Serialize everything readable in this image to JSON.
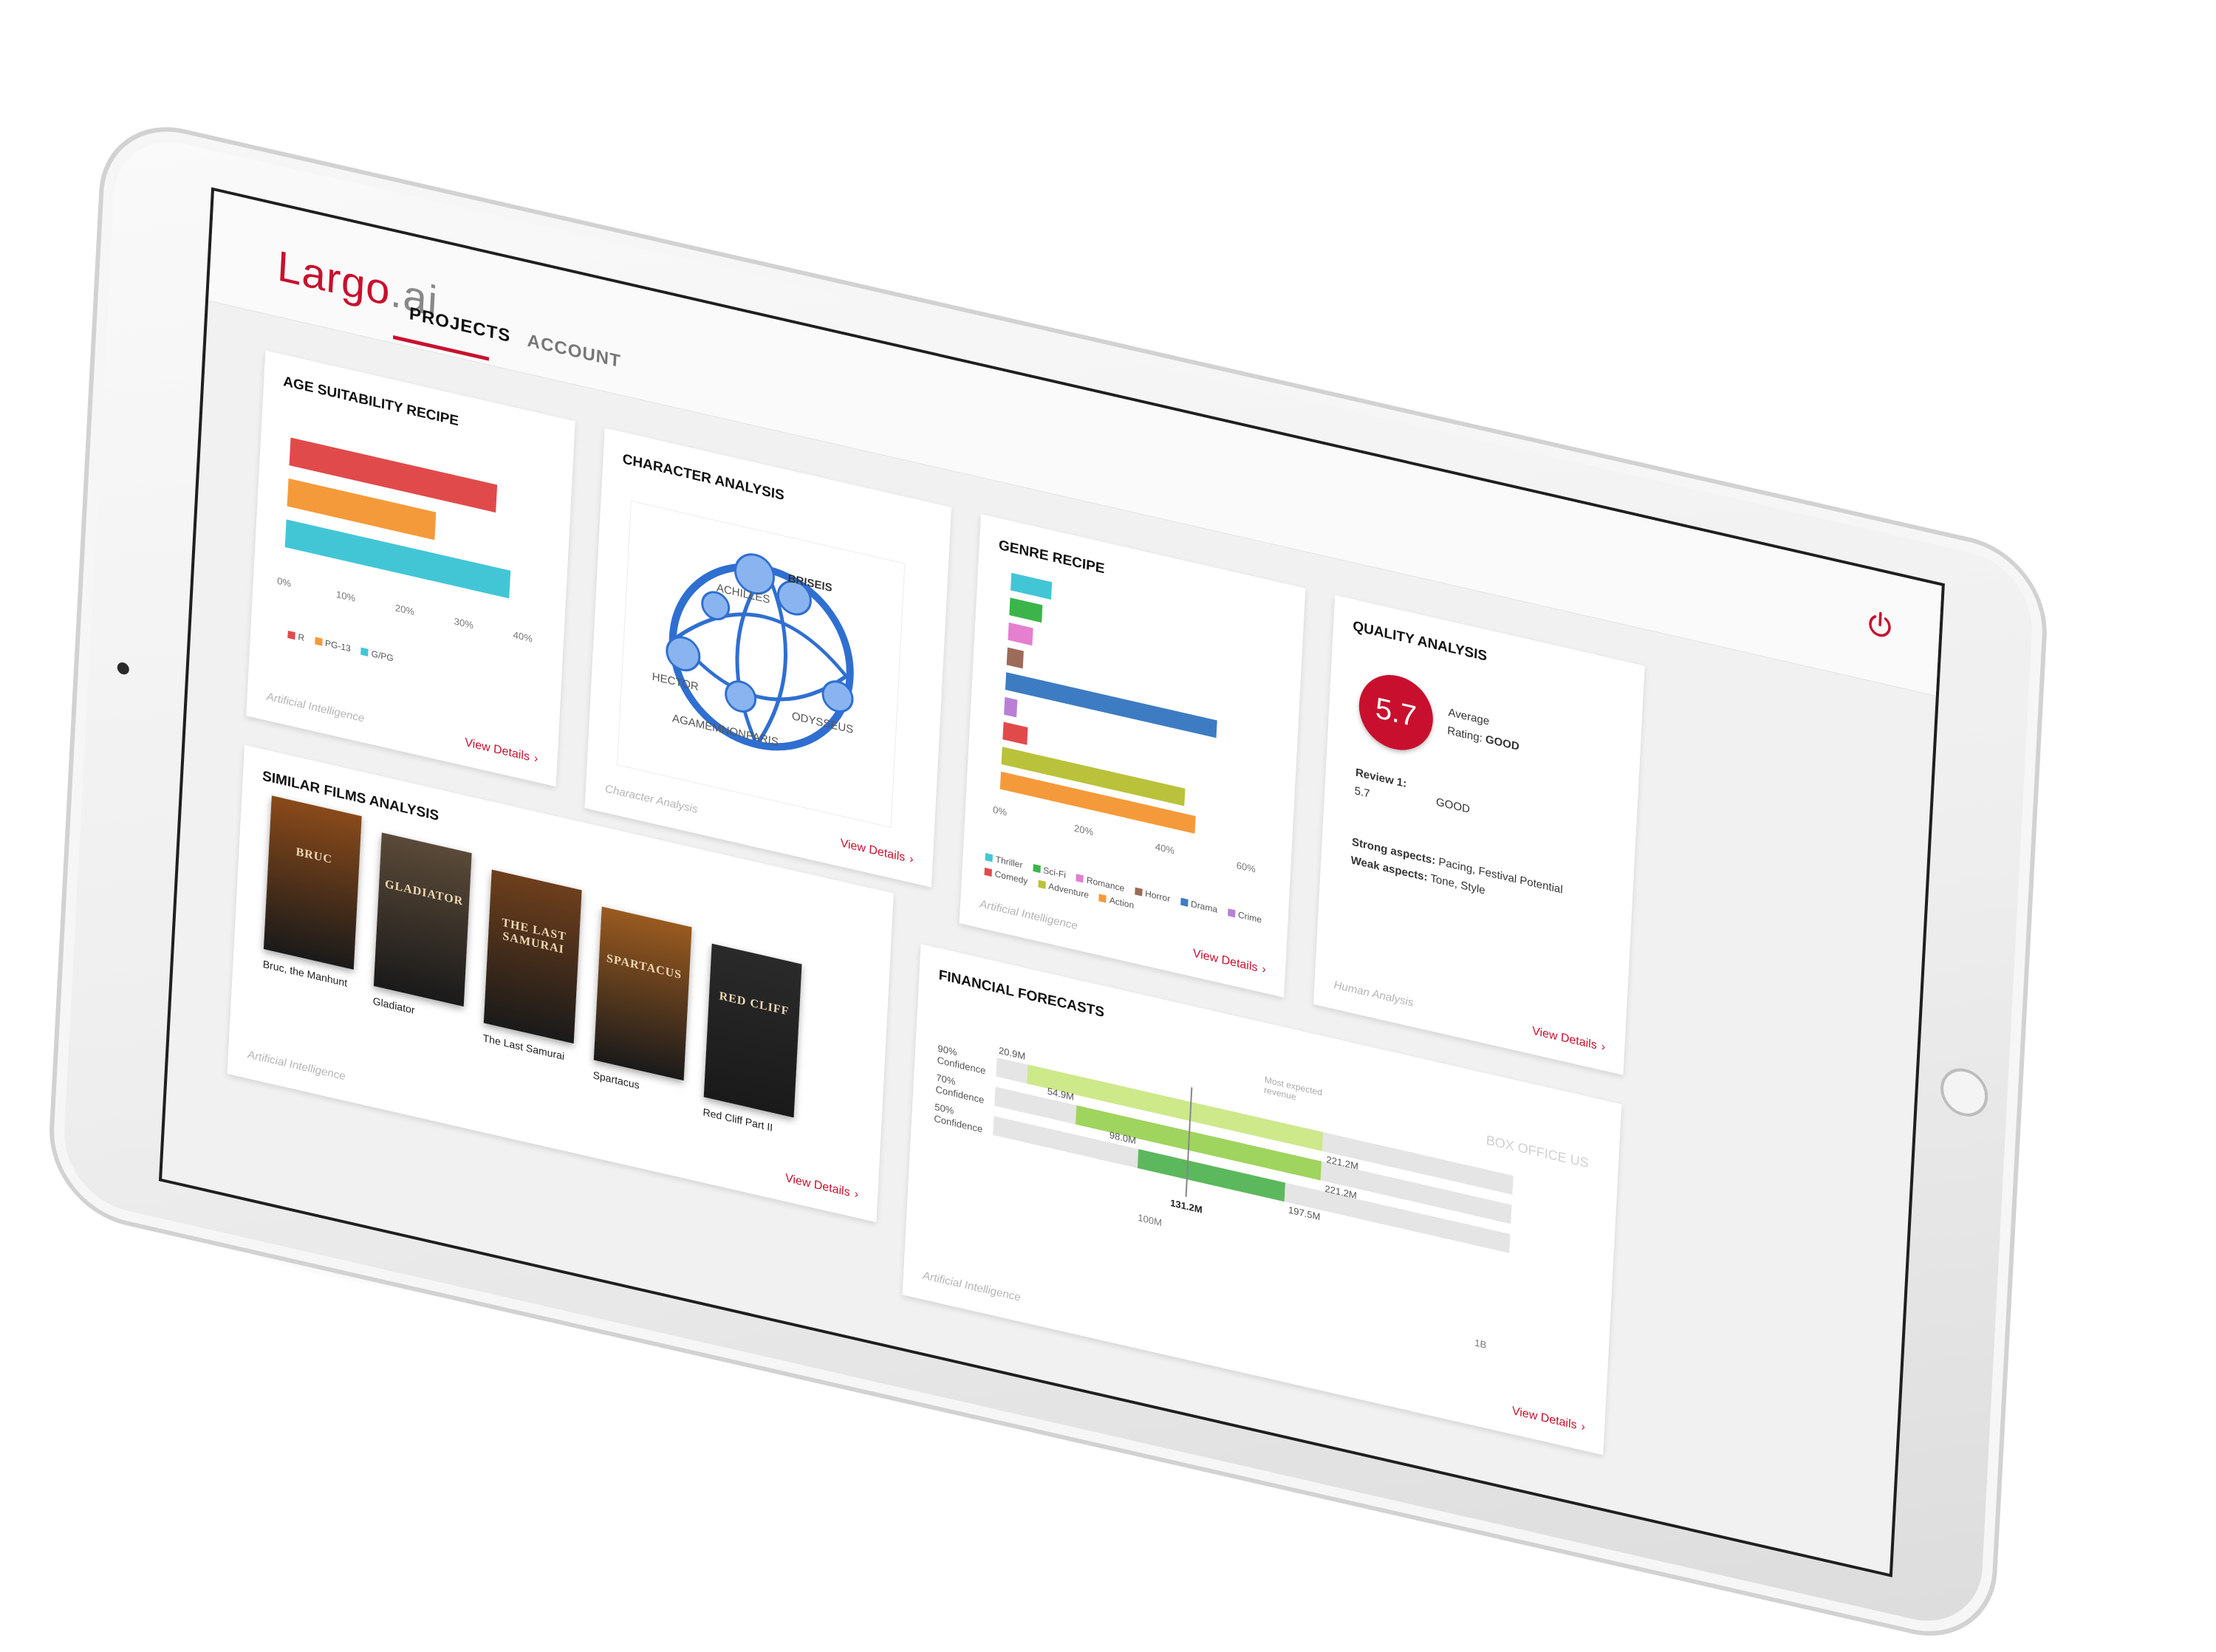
{
  "app": {
    "logo_main": "Largo",
    "logo_ai": ".ai",
    "tabs": [
      "PROJECTS",
      "ACCOUNT"
    ]
  },
  "icons": {
    "power": "power-icon",
    "chevron": "chevron-right-icon"
  },
  "colors": {
    "accent": "#c8102e"
  },
  "common": {
    "view_details": "View Details",
    "footer_ai": "Artificial Intelligence"
  },
  "age": {
    "title": "AGE SUITABILITY RECIPE",
    "chart_data": {
      "type": "bar",
      "orientation": "horizontal",
      "categories": [
        "R",
        "PG-13",
        "G/PG"
      ],
      "values": [
        35,
        25,
        38
      ],
      "colors": [
        "#e14a4a",
        "#f59a3a",
        "#42c6d6"
      ],
      "xlim": [
        0,
        40
      ],
      "ticks": [
        "0%",
        "10%",
        "20%",
        "30%",
        "40%"
      ]
    }
  },
  "character": {
    "title": "CHARACTER ANALYSIS",
    "footer": "Character Analysis",
    "nodes": [
      "ACHILLES",
      "BRISEIS",
      "HECTOR",
      "ODYSSEUS",
      "AGAMEMNON",
      "PARIS"
    ]
  },
  "genre": {
    "title": "GENRE RECIPE",
    "chart_data": {
      "type": "bar",
      "orientation": "horizontal",
      "categories": [
        "Thriller",
        "Sci-Fi",
        "Romance",
        "Horror",
        "Drama",
        "Crime",
        "Comedy",
        "Action",
        "Adventure"
      ],
      "values": [
        10,
        8,
        6,
        4,
        52,
        3,
        6,
        45,
        48
      ],
      "colors": [
        "#42c6d6",
        "#3bb54a",
        "#e57fcf",
        "#9c6b5a",
        "#3d7cc2",
        "#b97fd6",
        "#e14a4a",
        "#b9c23a",
        "#f59a3a"
      ],
      "xlim": [
        0,
        60
      ],
      "ticks": [
        "0%",
        "20%",
        "40%",
        "60%"
      ],
      "legend": [
        {
          "name": "Thriller",
          "color": "#42c6d6"
        },
        {
          "name": "Sci-Fi",
          "color": "#3bb54a"
        },
        {
          "name": "Romance",
          "color": "#e57fcf"
        },
        {
          "name": "Horror",
          "color": "#9c6b5a"
        },
        {
          "name": "Drama",
          "color": "#3d7cc2"
        },
        {
          "name": "Crime",
          "color": "#b97fd6"
        },
        {
          "name": "Comedy",
          "color": "#e14a4a"
        },
        {
          "name": "Adventure",
          "color": "#b9c23a"
        },
        {
          "name": "Action",
          "color": "#f59a3a"
        }
      ]
    }
  },
  "quality": {
    "title": "QUALITY ANALYSIS",
    "score": "5.7",
    "average_label": "Average",
    "rating_label": "Rating:",
    "rating_value": "GOOD",
    "review_label": "Review 1:",
    "review_score": "5.7",
    "review_value": "GOOD",
    "strong_label": "Strong aspects:",
    "strong_value": "Pacing, Festival Potential",
    "weak_label": "Weak aspects:",
    "weak_value": "Tone, Style",
    "footer": "Human Analysis"
  },
  "similar": {
    "title": "SIMILAR FILMS ANALYSIS",
    "films": [
      "Bruc, the Manhunt",
      "Gladiator",
      "The Last Samurai",
      "Spartacus",
      "Red Cliff Part II"
    ],
    "poster_texts": [
      "BRUC",
      "GLADIATOR",
      "THE LAST SAMURAI",
      "SPARTACUS",
      "RED CLIFF"
    ],
    "poster_colors": [
      "#8a4a1a",
      "#5a4a38",
      "#6e3f1c",
      "#9a5a20",
      "#2a2a2a"
    ]
  },
  "financial": {
    "title": "FINANCIAL FORECASTS",
    "box_office_label": "BOX OFFICE US",
    "most_expected_label": "Most expected revenue",
    "chart_data": {
      "type": "bar",
      "orientation": "range",
      "series": [
        {
          "name": "90% Confidence",
          "low": 20.9,
          "high": 221.2,
          "low_label": "20.9M",
          "high_label": "221.2M",
          "color": "#cde98a"
        },
        {
          "name": "70% Confidence",
          "low": 54.9,
          "high": 221.2,
          "low_label": "54.9M",
          "high_label": "221.2M",
          "color": "#9fd45e"
        },
        {
          "name": "50% Confidence",
          "low": 98.0,
          "high": 197.5,
          "low_label": "98.0M",
          "high_label": "197.5M",
          "color": "#5cb85c"
        }
      ],
      "expected": 131.2,
      "expected_label": "131.2M",
      "xlim": [
        0,
        350
      ],
      "ticks": [
        "100M",
        "1B"
      ]
    }
  }
}
